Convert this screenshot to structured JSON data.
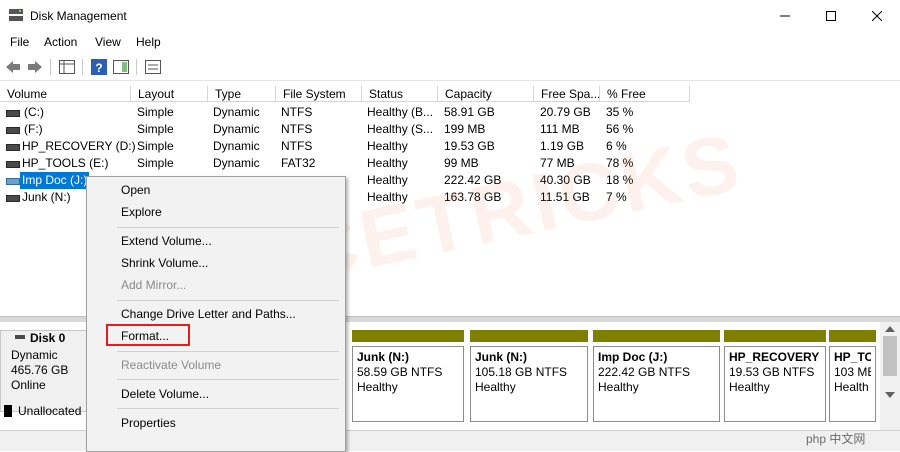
{
  "window": {
    "title": "Disk Management"
  },
  "menubar": {
    "items": [
      "File",
      "Action",
      "View",
      "Help"
    ]
  },
  "table": {
    "columns": [
      "Volume",
      "Layout",
      "Type",
      "File System",
      "Status",
      "Capacity",
      "Free Spa...",
      "% Free"
    ],
    "rows": [
      [
        "(C:)",
        "Simple",
        "Dynamic",
        "NTFS",
        "Healthy (B...",
        "58.91 GB",
        "20.79 GB",
        "35 %"
      ],
      [
        "(F:)",
        "Simple",
        "Dynamic",
        "NTFS",
        "Healthy (S...",
        "199 MB",
        "111 MB",
        "56 %"
      ],
      [
        "HP_RECOVERY (D:)",
        "Simple",
        "Dynamic",
        "NTFS",
        "Healthy",
        "19.53 GB",
        "1.19 GB",
        "6 %"
      ],
      [
        "HP_TOOLS (E:)",
        "Simple",
        "Dynamic",
        "FAT32",
        "Healthy",
        "99 MB",
        "77 MB",
        "78 %"
      ],
      [
        "Imp Doc (J:)",
        "",
        "",
        "",
        "Healthy",
        "222.42 GB",
        "40.30 GB",
        "18 %"
      ],
      [
        "Junk (N:)",
        "",
        "",
        "",
        "Healthy",
        "163.78 GB",
        "11.51 GB",
        "7 %"
      ]
    ]
  },
  "context_menu": {
    "items": [
      {
        "label": "Open",
        "enabled": true
      },
      {
        "label": "Explore",
        "enabled": true
      },
      {
        "label": "Extend Volume...",
        "enabled": true
      },
      {
        "label": "Shrink Volume...",
        "enabled": true
      },
      {
        "label": "Add Mirror...",
        "enabled": false
      },
      {
        "label": "Change Drive Letter and Paths...",
        "enabled": true
      },
      {
        "label": "Format...",
        "enabled": true
      },
      {
        "label": "Reactivate Volume",
        "enabled": false
      },
      {
        "label": "Delete Volume...",
        "enabled": true
      },
      {
        "label": "Properties",
        "enabled": true
      }
    ]
  },
  "disk": {
    "name": "Disk 0",
    "type": "Dynamic",
    "size": "465.76 GB",
    "status": "Online"
  },
  "partitions": [
    {
      "name": "Junk  (N:)",
      "size": "58.59 GB NTFS",
      "status": "Healthy"
    },
    {
      "name": "Junk  (N:)",
      "size": "105.18 GB NTFS",
      "status": "Healthy"
    },
    {
      "name": "Imp Doc  (J:)",
      "size": "222.42 GB NTFS",
      "status": "Healthy"
    },
    {
      "name": "HP_RECOVERY  (",
      "size": "19.53 GB NTFS",
      "status": "Healthy"
    },
    {
      "name": "HP_TO",
      "size": "103 ME",
      "status": "Health"
    }
  ],
  "legend": {
    "unallocated": "Unallocated"
  },
  "watermark": "VICETRICKS",
  "badge": "php 中文网",
  "colors": {
    "partition_bar": "#808000",
    "selection": "#0078d7",
    "highlight": "#e02020"
  }
}
